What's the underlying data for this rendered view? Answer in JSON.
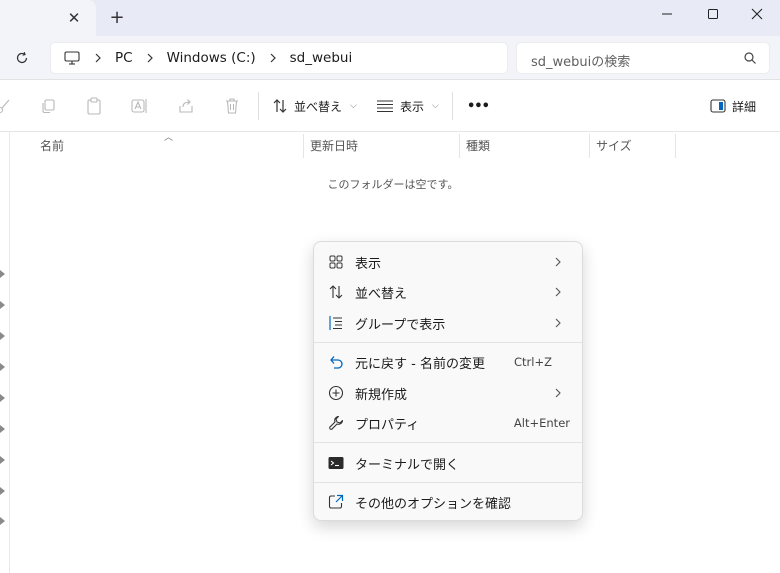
{
  "window": {
    "tab_close": "✕",
    "new_tab": "+"
  },
  "address": {
    "breadcrumb": [
      "PC",
      "Windows (C:)",
      "sd_webui"
    ]
  },
  "search": {
    "placeholder": "sd_webuiの検索"
  },
  "toolbar": {
    "sort_label": "並べ替え",
    "view_label": "表示",
    "more_label": "•••",
    "details_label": "詳細"
  },
  "columns": {
    "name": "名前",
    "modified": "更新日時",
    "type": "種類",
    "size": "サイズ"
  },
  "content": {
    "empty_message": "このフォルダーは空です。"
  },
  "context_menu": {
    "view": {
      "label": "表示"
    },
    "sort": {
      "label": "並べ替え"
    },
    "group": {
      "label": "グループで表示"
    },
    "undo": {
      "label": "元に戻す - 名前の変更",
      "shortcut": "Ctrl+Z"
    },
    "new": {
      "label": "新規作成"
    },
    "properties": {
      "label": "プロパティ",
      "shortcut": "Alt+Enter"
    },
    "terminal": {
      "label": "ターミナルで開く"
    },
    "more_options": {
      "label": "その他のオプションを確認"
    }
  },
  "colors": {
    "accent": "#0067c0",
    "tabbar": "#e8eaf6",
    "addressbar": "#f3f4fa"
  }
}
